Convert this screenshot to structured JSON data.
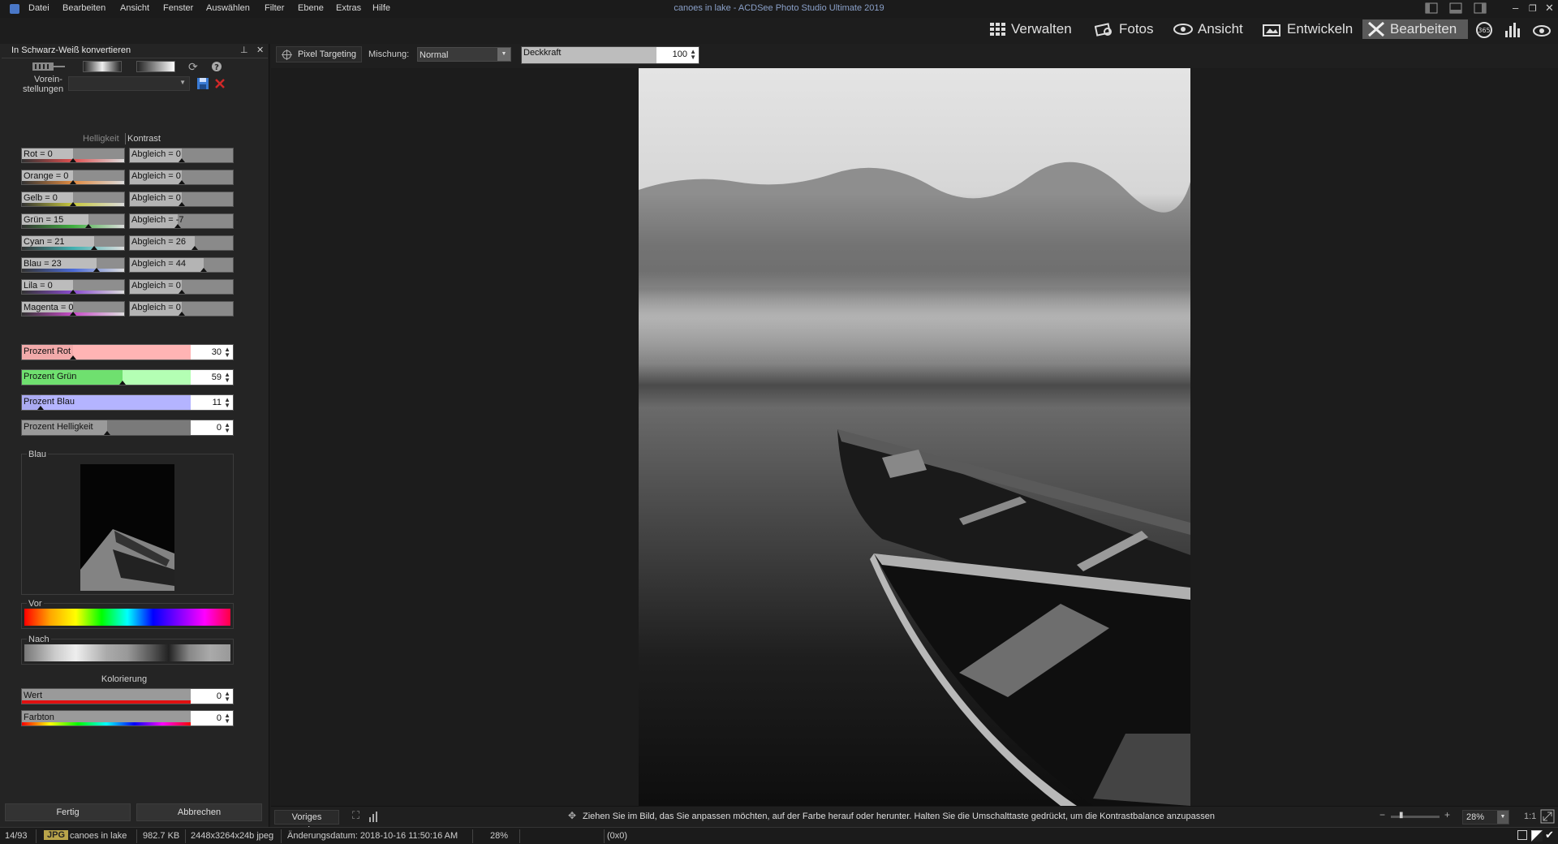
{
  "app": {
    "title": "canoes in lake - ACDSee Photo Studio Ultimate 2019",
    "menu": [
      "Datei",
      "Bearbeiten",
      "Ansicht",
      "Fenster",
      "Auswählen",
      "Filter",
      "Ebene",
      "Extras",
      "Hilfe"
    ]
  },
  "modes": {
    "verwalten": "Verwalten",
    "fotos": "Fotos",
    "ansicht": "Ansicht",
    "entwickeln": "Entwickeln",
    "bearbeiten": "Bearbeiten"
  },
  "panel": {
    "title": "In Schwarz-Weiß konvertieren",
    "presets_label_1": "Vorein-",
    "presets_label_2": "stellungen",
    "presets_value": "",
    "header_brightness": "Helligkeit",
    "header_contrast": "Kontrast",
    "colors": [
      {
        "label": "Rot = 0",
        "balance": "Abgleich = 0",
        "value": 0,
        "bal": 0,
        "strip": "#e05050"
      },
      {
        "label": "Orange = 0",
        "balance": "Abgleich = 0",
        "value": 0,
        "bal": 0,
        "strip": "#e08a40"
      },
      {
        "label": "Gelb = 0",
        "balance": "Abgleich = 0",
        "value": 0,
        "bal": 0,
        "strip": "#c8c83c"
      },
      {
        "label": "Grün = 15",
        "balance": "Abgleich = -7",
        "value": 15,
        "bal": -7,
        "strip": "#40b040"
      },
      {
        "label": "Cyan = 21",
        "balance": "Abgleich = 26",
        "value": 21,
        "bal": 26,
        "strip": "#40b0b0"
      },
      {
        "label": "Blau = 23",
        "balance": "Abgleich = 44",
        "value": 23,
        "bal": 44,
        "strip": "#4a6ad8"
      },
      {
        "label": "Lila = 0",
        "balance": "Abgleich = 0",
        "value": 0,
        "bal": 0,
        "strip": "#8a4ad0"
      },
      {
        "label": "Magenta = 0",
        "balance": "Abgleich = 0",
        "value": 0,
        "bal": 0,
        "strip": "#c84ac8"
      }
    ],
    "percent": [
      {
        "label": "Prozent Rot",
        "value": "30",
        "color": "#ffb4b4",
        "pct": 30
      },
      {
        "label": "Prozent Grün",
        "value": "59",
        "color": "#b4ffb4",
        "pct": 59
      },
      {
        "label": "Prozent Blau",
        "value": "11",
        "color": "#b4b4ff",
        "pct": 11
      },
      {
        "label": "Prozent Helligkeit",
        "value": "0",
        "color": "#9a9a9a",
        "pct": 50
      }
    ],
    "channel_group": "Blau",
    "before_label": "Vor",
    "after_label": "Nach",
    "colorize_title": "Kolorierung",
    "colorize": [
      {
        "label": "Wert",
        "value": "0"
      },
      {
        "label": "Farbton",
        "value": "0"
      }
    ],
    "done_button": "Fertig",
    "cancel_button": "Abbrechen"
  },
  "toolbar": {
    "pixel_targeting": "Pixel Targeting",
    "blend_label": "Mischung:",
    "blend_value": "Normal",
    "opacity_label": "Deckkraft",
    "opacity_value": "100"
  },
  "bottom": {
    "show_previous": "Voriges anzeigen",
    "hint": "Ziehen Sie im Bild, das Sie anpassen möchten, auf der Farbe herauf oder herunter.  Halten Sie die Umschalttaste gedrückt, um die Kontrastbalance anzupassen",
    "zoom": "28%",
    "ratio": "1:1"
  },
  "status": {
    "index": "14/93",
    "format": "JPG",
    "filename": "canoes in lake",
    "size": "982.7 KB",
    "dims": "2448x3264x24b jpeg",
    "date": "Änderungsdatum: 2018-10-16 11:50:16 AM",
    "zoom": "28%",
    "coords": "(0x0)"
  }
}
